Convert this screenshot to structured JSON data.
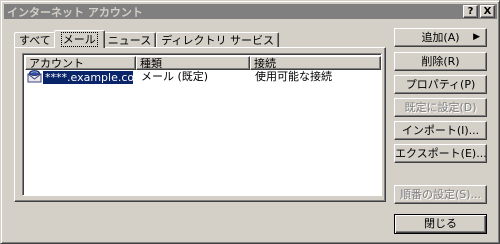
{
  "window": {
    "title": "インターネット アカウント",
    "help_label": "?",
    "close_label": "X"
  },
  "tabs": [
    {
      "label": "すべて"
    },
    {
      "label": "メール",
      "active": true
    },
    {
      "label": "ニュース"
    },
    {
      "label": "ディレクトリ サービス"
    }
  ],
  "list": {
    "columns": [
      "アカウント",
      "種類",
      "接続"
    ],
    "rows": [
      {
        "account": "****.example.com",
        "type": "メール (既定)",
        "connection": "使用可能な接続",
        "selected": true,
        "icon": "mail-account-icon"
      }
    ]
  },
  "buttons": {
    "add": "追加(A)",
    "add_arrow": "▶",
    "delete": "削除(R)",
    "properties": "プロパティ(P)",
    "set_default": "既定に設定(D)",
    "import": "インポート(I)...",
    "export": "エクスポート(E)...",
    "order": "順番の設定(S)...",
    "close": "閉じる"
  },
  "colors": {
    "selection": "#0a246a",
    "face": "#d4d0c8",
    "titlebar_inactive": "#808080"
  }
}
